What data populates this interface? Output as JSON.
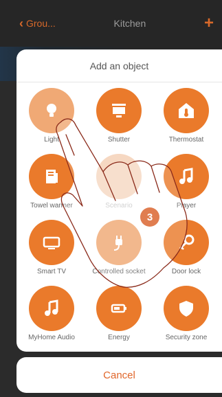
{
  "topbar": {
    "back_label": "Grou...",
    "title": "Kitchen",
    "add_symbol": "+"
  },
  "sheet": {
    "title": "Add an object",
    "items": [
      {
        "label": "Light",
        "icon": "bulb-icon"
      },
      {
        "label": "Shutter",
        "icon": "shutter-icon"
      },
      {
        "label": "Thermostat",
        "icon": "thermostat-icon"
      },
      {
        "label": "Towel warmer",
        "icon": "towel-warmer-icon"
      },
      {
        "label": "Scenario",
        "icon": "scenario-icon"
      },
      {
        "label": "Player",
        "icon": "music-note-icon"
      },
      {
        "label": "Smart TV",
        "icon": "tv-icon"
      },
      {
        "label": "Controlled socket",
        "icon": "plug-icon"
      },
      {
        "label": "Door lock",
        "icon": "key-icon"
      },
      {
        "label": "MyHome Audio",
        "icon": "music-note-icon"
      },
      {
        "label": "Energy",
        "icon": "battery-icon"
      },
      {
        "label": "Security zone",
        "icon": "shield-icon"
      }
    ],
    "step_badge": "3"
  },
  "cancel_label": "Cancel",
  "colors": {
    "accent": "#ea7a2b",
    "cancel_text": "#e0662a",
    "badge": "#d9612a"
  }
}
